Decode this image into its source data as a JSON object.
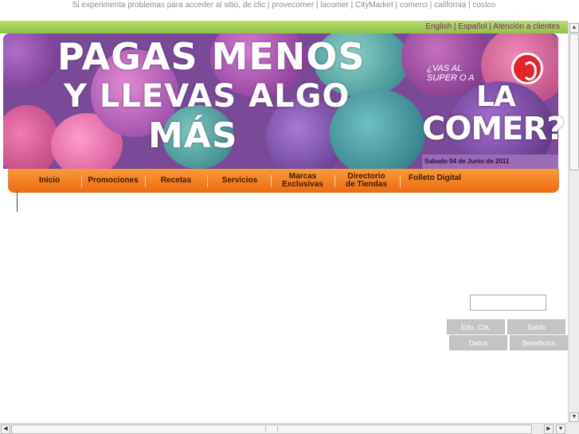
{
  "top_links": {
    "intro": "Si experimenta problemas para acceder al sitio, de clic",
    "links": [
      "provecomer",
      "lacomer",
      "CityMarket",
      "comerci",
      "california",
      "costco"
    ]
  },
  "lang_bar": [
    "English",
    "Español",
    "Atención a clientes"
  ],
  "banner": {
    "headline_1": "PAGAS MENOS",
    "headline_2": "Y LLEVAS ALGO",
    "headline_3": "MÁS",
    "brand_small_1": "¿VAS AL",
    "brand_small_2": "SUPER O A",
    "brand_la": "LA",
    "brand_comer": "COMER?",
    "date": "Sabado 04 de Junio de 2011"
  },
  "nav": {
    "items": [
      {
        "line1": "Inicio",
        "line2": ""
      },
      {
        "line1": "Promociones",
        "line2": ""
      },
      {
        "line1": "Recetas",
        "line2": ""
      },
      {
        "line1": "Servicios",
        "line2": ""
      },
      {
        "line1": "Marcas",
        "line2": "Exclusivas"
      },
      {
        "line1": "Directorio",
        "line2": "de Tiendas"
      },
      {
        "line1": "Folleto Digital",
        "line2": ""
      }
    ]
  },
  "account": {
    "search_value": "",
    "buttons": [
      "Edo. Cta.",
      "Saldo",
      "Datos",
      "Beneficios"
    ]
  },
  "colors": {
    "green": "#8fc24a",
    "orange": "#ee6a10",
    "purple": "#9c6bb5",
    "brand_red": "#e2242c"
  }
}
